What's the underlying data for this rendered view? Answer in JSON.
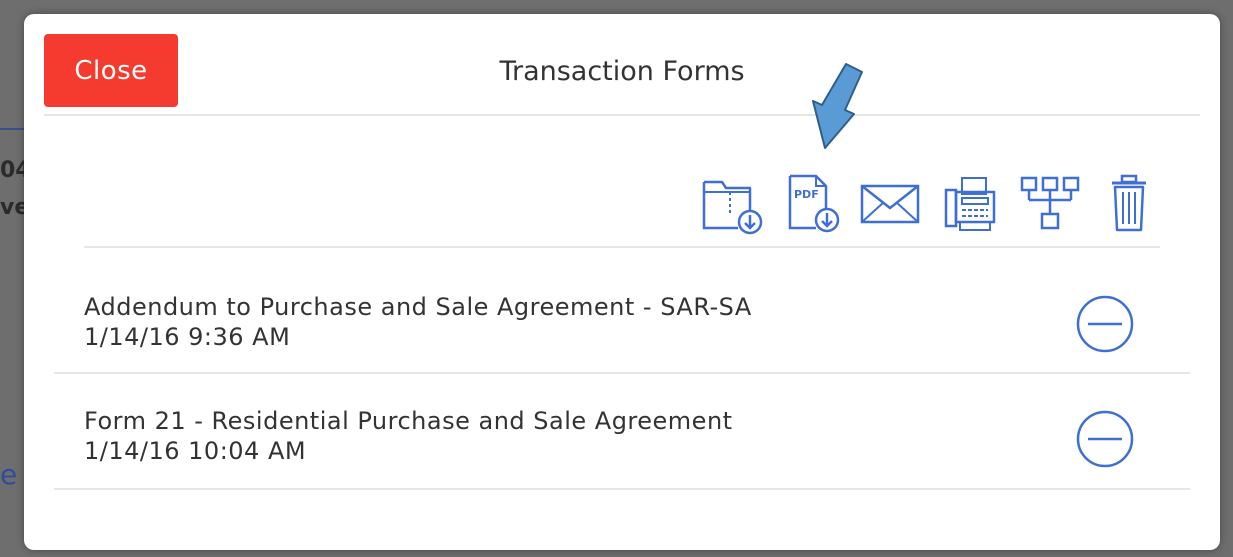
{
  "modal": {
    "title": "Transaction Forms",
    "close_label": "Close"
  },
  "toolbar": {
    "icons": [
      "download-zip-icon",
      "download-pdf-icon",
      "email-icon",
      "fax-icon",
      "hierarchy-icon",
      "trash-icon"
    ],
    "pdf_icon_text": "PDF"
  },
  "forms": [
    {
      "name": "Addendum to Purchase and Sale Agreement - SAR-SA",
      "date": "1/14/16 9:36 AM"
    },
    {
      "name": "Form 21 - Residential Purchase and Sale Agreement",
      "date": "1/14/16 10:04 AM"
    }
  ],
  "background": {
    "frag1": "04",
    "frag2": "ve",
    "frag3": "e"
  },
  "colors": {
    "close_button": "#f53b2f",
    "icon_blue": "#3f6fd3",
    "arrow_fill": "#5b9bd5",
    "arrow_stroke": "#2e5f8a"
  }
}
